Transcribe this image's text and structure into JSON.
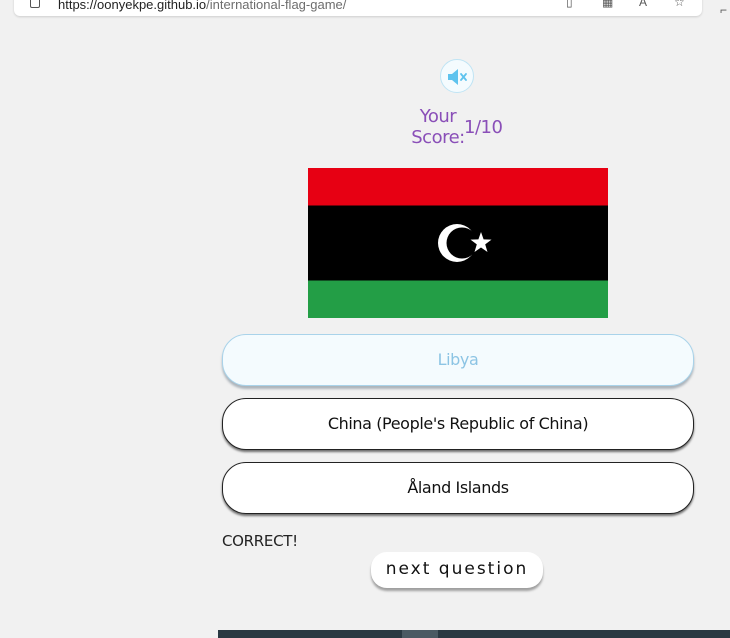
{
  "browser": {
    "url_host": "https://oonyekpe.github.io",
    "url_path": "/international-flag-game/"
  },
  "score": {
    "label": "Your Score:",
    "value": "1/10"
  },
  "flag": {
    "country": "Libya",
    "colors": {
      "top": "#e70013",
      "middle": "#000000",
      "bottom": "#239e46",
      "emblem": "#ffffff"
    }
  },
  "answers": [
    {
      "label": "Libya",
      "state": "correct"
    },
    {
      "label": "China (People's Republic of China)",
      "state": "normal"
    },
    {
      "label": "Åland Islands",
      "state": "normal"
    }
  ],
  "status": "CORRECT!",
  "next_button": "next question",
  "colors": {
    "score": "#8a4fb8",
    "correct_text": "#8cc4e4",
    "sound_icon": "#5ec3ee"
  },
  "icons": {
    "sound": "speaker-muted-icon"
  }
}
